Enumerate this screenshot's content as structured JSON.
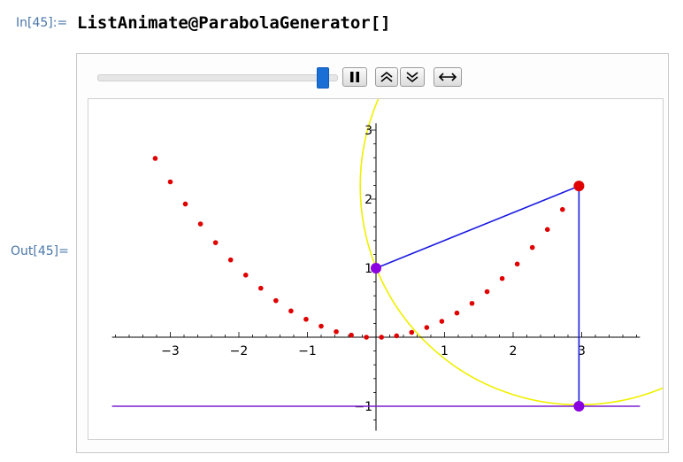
{
  "cell": {
    "in_label": "In[45]:=",
    "out_label": "Out[45]=",
    "input_code": "ListAnimate@ParabolaGenerator[]"
  },
  "animator": {
    "slider_position": 0.94,
    "state": "playing",
    "buttons": [
      "pause",
      "faster",
      "slower",
      "direction"
    ]
  },
  "colors": {
    "parabola_points": "#e00000",
    "construction_lines": "#1a1ae0",
    "directrix": "#7a1fd0",
    "circle": "#f0f000",
    "focus_marker": "#8a00e0",
    "foot_marker": "#8a00e0",
    "moving_point": "#e00000",
    "label_blue": "#4a76a8"
  },
  "chart_data": {
    "type": "scatter",
    "xlim": [
      -3.85,
      3.85
    ],
    "ylim": [
      -1.2,
      3.1
    ],
    "x_ticks": [
      -3,
      -2,
      -1,
      1,
      2,
      3
    ],
    "y_ticks": [
      -1,
      1,
      2,
      3
    ],
    "x_tick_labels": [
      "−3",
      "−2",
      "−1",
      "1",
      "2",
      "3"
    ],
    "y_tick_labels": [
      "−1",
      "1",
      "2",
      "3"
    ],
    "parabola_points": [
      [
        -3.22,
        2.59
      ],
      [
        -3.0,
        2.25
      ],
      [
        -2.78,
        1.93
      ],
      [
        -2.56,
        1.64
      ],
      [
        -2.34,
        1.37
      ],
      [
        -2.12,
        1.12
      ],
      [
        -1.9,
        0.9
      ],
      [
        -1.68,
        0.71
      ],
      [
        -1.46,
        0.53
      ],
      [
        -1.24,
        0.38
      ],
      [
        -1.02,
        0.26
      ],
      [
        -0.8,
        0.16
      ],
      [
        -0.58,
        0.08
      ],
      [
        -0.36,
        0.03
      ],
      [
        -0.14,
        0.0
      ],
      [
        0.08,
        0.0
      ],
      [
        0.3,
        0.02
      ],
      [
        0.52,
        0.07
      ],
      [
        0.74,
        0.14
      ],
      [
        0.96,
        0.23
      ],
      [
        1.18,
        0.35
      ],
      [
        1.4,
        0.49
      ],
      [
        1.62,
        0.66
      ],
      [
        1.84,
        0.85
      ],
      [
        2.06,
        1.06
      ],
      [
        2.28,
        1.3
      ],
      [
        2.5,
        1.56
      ],
      [
        2.72,
        1.85
      ]
    ],
    "focus": [
      0,
      1
    ],
    "moving_point": [
      2.96,
      2.19
    ],
    "foot_point": [
      2.96,
      -1
    ],
    "directrix_y": -1,
    "circle": {
      "center": [
        2.96,
        2.19
      ],
      "radius": 3.19
    }
  }
}
